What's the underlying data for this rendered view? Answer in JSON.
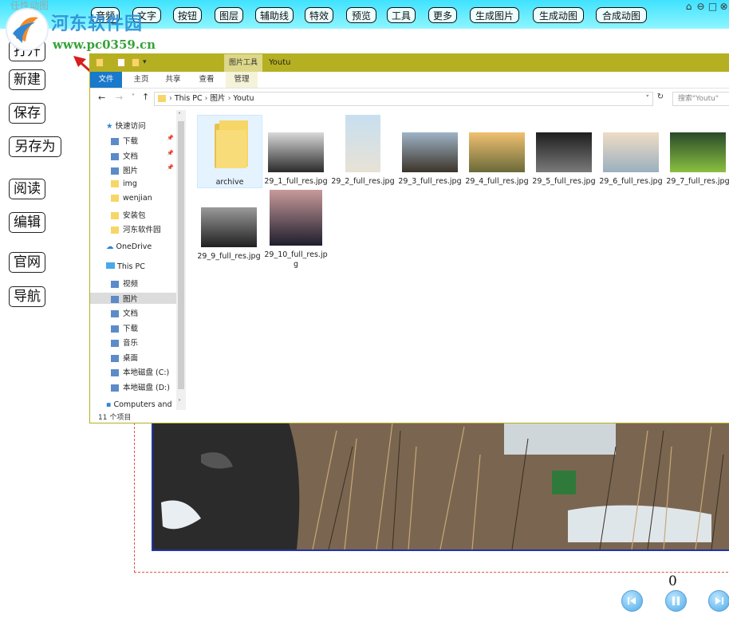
{
  "app": {
    "title": "任性动图"
  },
  "toolbar": {
    "items": [
      "音频",
      "文字",
      "按钮",
      "图层",
      "辅助线",
      "特效",
      "预览",
      "工具",
      "更多",
      "生成图片",
      "生成动图",
      "合成动图"
    ]
  },
  "sidebar": {
    "items": [
      "打开",
      "新建",
      "保存",
      "另存为",
      "阅读",
      "编辑",
      "官网",
      "导航"
    ]
  },
  "watermark": {
    "site_name": "河东软件园",
    "url": "www.pc0359.cn"
  },
  "player": {
    "frame": "0"
  },
  "explorer": {
    "context_tab_title": "图片工具",
    "title": "Youtu",
    "ribbon_tabs": [
      "文件",
      "主页",
      "共享",
      "查看",
      "管理"
    ],
    "breadcrumb": [
      "This PC",
      "图片",
      "Youtu"
    ],
    "search_placeholder": "搜索\"Youtu\"",
    "nav": {
      "quick_access": "快速访问",
      "quick_items": [
        "下载",
        "文档",
        "图片",
        "img",
        "wenjian",
        "安装包",
        "河东软件园"
      ],
      "onedrive": "OneDrive",
      "this_pc": "This PC",
      "pc_items": [
        "视频",
        "图片",
        "文档",
        "下载",
        "音乐",
        "桌面",
        "本地磁盘 (C:)",
        "本地磁盘 (D:)"
      ],
      "network": "Computers and"
    },
    "status": "11 个项目",
    "files": [
      {
        "name": "archive",
        "kind": "folder"
      },
      {
        "name": "29_1_full_res.jpg",
        "kind": "image",
        "colors": [
          "#d9d9d9",
          "#2a2a2a"
        ]
      },
      {
        "name": "29_2_full_res.jpg",
        "kind": "image",
        "colors": [
          "#c7dff0",
          "#e8e2d5"
        ]
      },
      {
        "name": "29_3_full_res.jpg",
        "kind": "image",
        "colors": [
          "#9fb3c8",
          "#3c3428"
        ]
      },
      {
        "name": "29_4_full_res.jpg",
        "kind": "image",
        "colors": [
          "#f0c070",
          "#6a6a3a"
        ]
      },
      {
        "name": "29_5_full_res.jpg",
        "kind": "image",
        "colors": [
          "#1e1e1e",
          "#7a7a7a"
        ]
      },
      {
        "name": "29_6_full_res.jpg",
        "kind": "image",
        "colors": [
          "#efdcc4",
          "#9ab0c0"
        ]
      },
      {
        "name": "29_7_full_res.jpg",
        "kind": "image",
        "colors": [
          "#2a4a2a",
          "#8ac040"
        ]
      },
      {
        "name": "29_9_full_res.jpg",
        "kind": "image",
        "colors": [
          "#9a9a9a",
          "#202020"
        ]
      },
      {
        "name": "29_10_full_res.jpg",
        "kind": "image",
        "colors": [
          "#c89a9a",
          "#1e1e2e"
        ]
      }
    ]
  }
}
